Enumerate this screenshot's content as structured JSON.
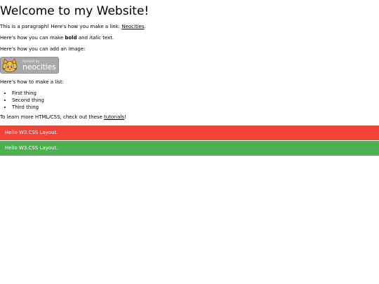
{
  "heading": "Welcome to my Website!",
  "paragraph_link": {
    "before": "This is a paragraph! Here's how you make a link: ",
    "link_text": "Neocities",
    "after": "."
  },
  "paragraph_format": {
    "before": "Here's how you can make ",
    "bold_text": "bold",
    "middle": " and ",
    "italic_text": "italic",
    "after": " text."
  },
  "image_intro": "Here's how you can add an image:",
  "badge": {
    "small_text": "hosted by",
    "brand_text": "neocities",
    "icon": "cat-mascot-icon"
  },
  "list_intro": "Here's how to make a list:",
  "list_items": [
    "First thing",
    "Second thing",
    "Third thing"
  ],
  "tutorial_paragraph": {
    "before": "To learn more HTML/CSS, check out these ",
    "link_text": "tutorials",
    "after": "!"
  },
  "bars": [
    {
      "text": "Hello W3.CSS Layout.",
      "color": "#f44336"
    },
    {
      "text": "Hello W3.CSS Layout.",
      "color": "#4caf50"
    }
  ]
}
